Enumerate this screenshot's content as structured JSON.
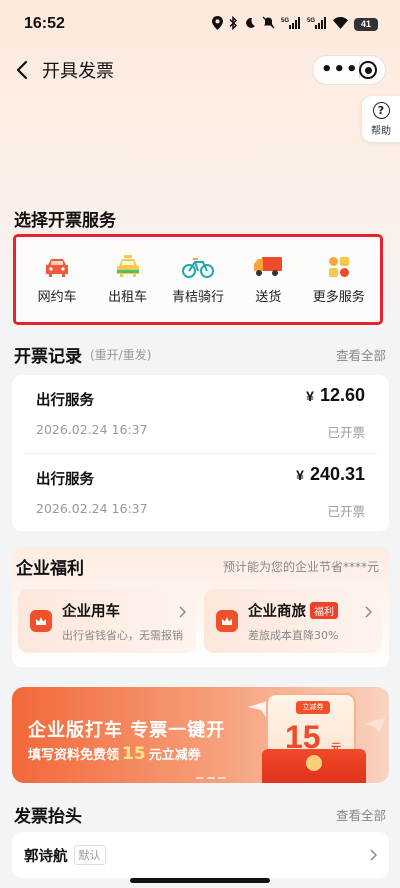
{
  "status_bar": {
    "time": "16:52",
    "signal_5g_1": "5G",
    "signal_5g_2": "5G",
    "battery": "41"
  },
  "nav": {
    "title": "开具发票",
    "more": "•••"
  },
  "help": {
    "icon": "?",
    "label": "帮助"
  },
  "services": {
    "title": "选择开票服务",
    "items": [
      {
        "label": "网约车",
        "icon": "car-icon",
        "color": "#ef5a3c"
      },
      {
        "label": "出租车",
        "icon": "taxi-icon",
        "color": "#f7c94b"
      },
      {
        "label": "青桔骑行",
        "icon": "bike-icon",
        "color": "#1fa7b4"
      },
      {
        "label": "送货",
        "icon": "truck-icon",
        "color": "#ef4a2a"
      },
      {
        "label": "更多服务",
        "icon": "more-services-icon",
        "color": "#f7a63a"
      }
    ]
  },
  "records": {
    "title": "开票记录",
    "subtitle": "(重开/重发)",
    "view_all": "查看全部",
    "items": [
      {
        "name": "出行服务",
        "date": "2026.02.24 16:37",
        "currency": "¥",
        "amount": "12.60",
        "status": "已开票"
      },
      {
        "name": "出行服务",
        "date": "2026.02.24 16:37",
        "currency": "¥",
        "amount": "240.31",
        "status": "已开票"
      }
    ]
  },
  "benefits": {
    "title": "企业福利",
    "note": "预计能为您的企业节省****元",
    "items": [
      {
        "title": "企业用车",
        "badge": "",
        "desc": "出行省钱省心，无需报销"
      },
      {
        "title": "企业商旅",
        "badge": "福利",
        "desc": "差旅成本直降30%"
      }
    ]
  },
  "banner": {
    "title": "企业版打车 专票一键开",
    "sub_prefix": "填写资料免费领",
    "sub_amount": "15",
    "sub_suffix": "元立减券",
    "coupon_tag": "立减券",
    "coupon_value": "15",
    "coupon_unit": "元"
  },
  "invoice_header": {
    "title": "发票抬头",
    "view_all": "查看全部",
    "name": "郭诗航",
    "badge": "默认"
  },
  "colors": {
    "accent": "#ef4a2a",
    "highlight_border": "#e8232f"
  }
}
